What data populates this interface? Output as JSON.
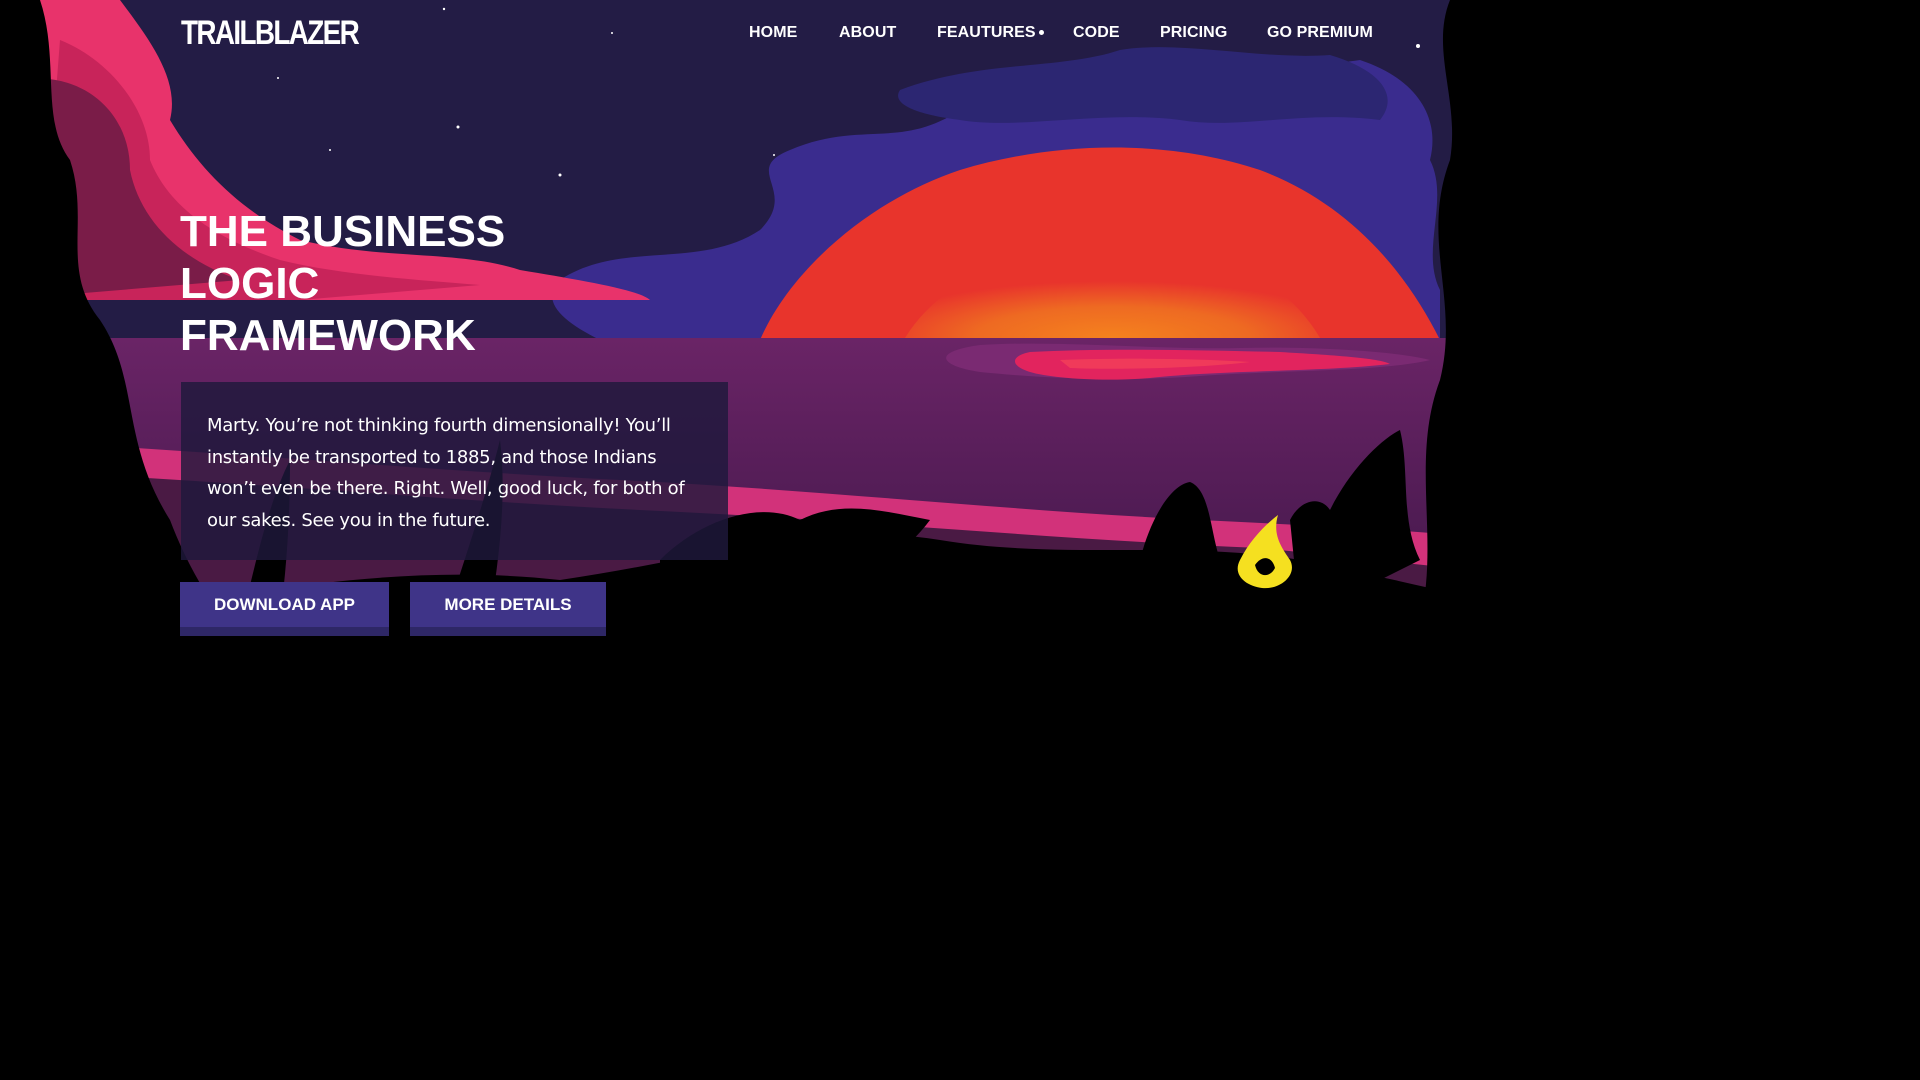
{
  "brand": {
    "logo_text": "TRAILBLAZER"
  },
  "nav": {
    "items": [
      {
        "label": "HOME"
      },
      {
        "label": "ABOUT"
      },
      {
        "label": "FEAUTURES"
      },
      {
        "label": "CODE"
      },
      {
        "label": "PRICING"
      },
      {
        "label": "GO PREMIUM"
      }
    ]
  },
  "hero": {
    "title_lines": [
      "THE BUSINESS",
      "LOGIC",
      "FRAMEWORK"
    ],
    "body": "Marty. You’re not thinking fourth dimensionally! You’ll instantly be transported to 1885, and those Indians won’t even be there. Right. Well, good luck, for both of our sakes. See you in the future.",
    "buttons": {
      "download": "DOWNLOAD APP",
      "details": "MORE DETAILS"
    }
  },
  "colors": {
    "sky": "#231c45",
    "clouds_purple": "#3a2a8a",
    "clouds_pink": "#e8336b",
    "sun_red": "#e83a2e",
    "sun_orange": "#f07a1a",
    "sea": "#5a1f5c",
    "foliage": "#000000",
    "button": "#3f3488"
  }
}
